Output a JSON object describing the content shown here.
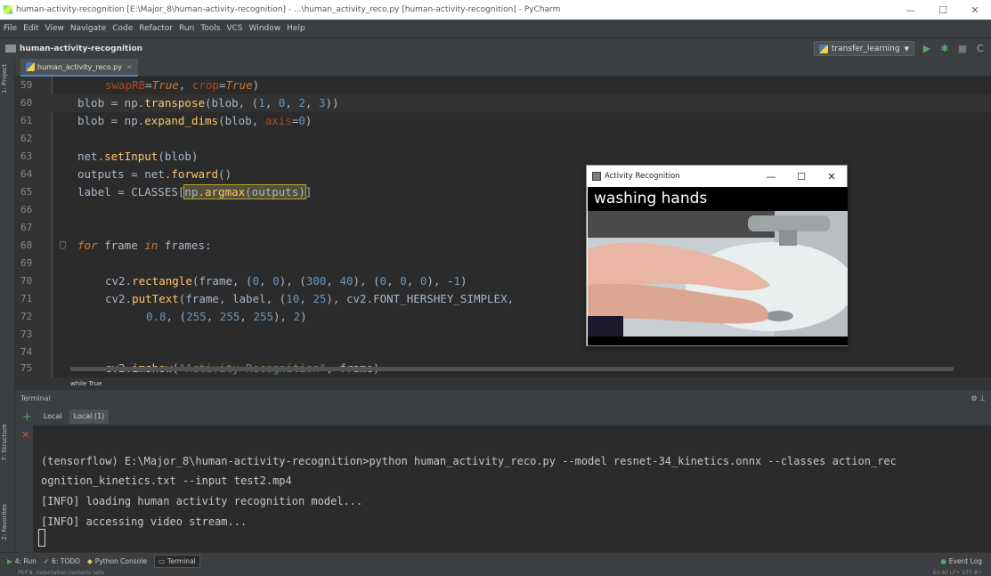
{
  "window": {
    "title": "human-activity-recognition [E:\\Major_8\\human-activity-recognition] - ...\\human_activity_reco.py [human-activity-recognition] - PyCharm",
    "minimize": "—",
    "maximize": "☐",
    "close": "✕"
  },
  "menu": [
    "File",
    "Edit",
    "View",
    "Navigate",
    "Code",
    "Refactor",
    "Run",
    "Tools",
    "VCS",
    "Window",
    "Help"
  ],
  "nav": {
    "project": "human-activity-recognition",
    "run_config": "transfer_learning"
  },
  "side_tools": {
    "project": "1: Project",
    "structure": "7: Structure",
    "favorites": "2: Favorites"
  },
  "editor": {
    "tab": "human_activity_reco.py",
    "lines": [
      {
        "n": "59",
        "t": "swapRB=True, crop=True)"
      },
      {
        "n": "60",
        "t": "blob = np.transpose(blob, (1, 0, 2, 3))"
      },
      {
        "n": "61",
        "t": "blob = np.expand_dims(blob, axis=0)"
      },
      {
        "n": "62",
        "t": ""
      },
      {
        "n": "63",
        "t": "net.setInput(blob)"
      },
      {
        "n": "64",
        "t": "outputs = net.forward()"
      },
      {
        "n": "65",
        "t": "label = CLASSES[np.argmax(outputs)]"
      },
      {
        "n": "66",
        "t": ""
      },
      {
        "n": "67",
        "t": ""
      },
      {
        "n": "68",
        "t": "for frame in frames:"
      },
      {
        "n": "69",
        "t": ""
      },
      {
        "n": "70",
        "t": "cv2.rectangle(frame, (0, 0), (300, 40), (0, 0, 0), -1)"
      },
      {
        "n": "71",
        "t": "cv2.putText(frame, label, (10, 25), cv2.FONT_HERSHEY_SIMPLEX,"
      },
      {
        "n": "72",
        "t": "0.8, (255, 255, 255), 2)"
      },
      {
        "n": "73",
        "t": ""
      },
      {
        "n": "74",
        "t": ""
      },
      {
        "n": "75",
        "t": "cv2.imshow(\"Activity Recognition\", frame)"
      }
    ],
    "breadcrumb": "while True"
  },
  "popup": {
    "title": "Activity Recognition",
    "label": "washing hands"
  },
  "terminal": {
    "header": "Terminal",
    "tabs": [
      "Local",
      "Local (1)"
    ],
    "lines": [
      "(tensorflow) E:\\Major_8\\human-activity-recognition>python human_activity_reco.py --model resnet-34_kinetics.onnx --classes action_rec",
      "ognition_kinetics.txt --input test2.mp4",
      "[INFO] loading human activity recognition model...",
      "[INFO] accessing video stream..."
    ]
  },
  "bottom_tools": {
    "run": "4: Run",
    "todo": "6: TODO",
    "console": "Python Console",
    "terminal": "Terminal",
    "event_log": "Event Log"
  },
  "status": {
    "left": "PEP 8: indentation contains tabs",
    "right": "60:40  LF÷  UTF-8÷"
  }
}
